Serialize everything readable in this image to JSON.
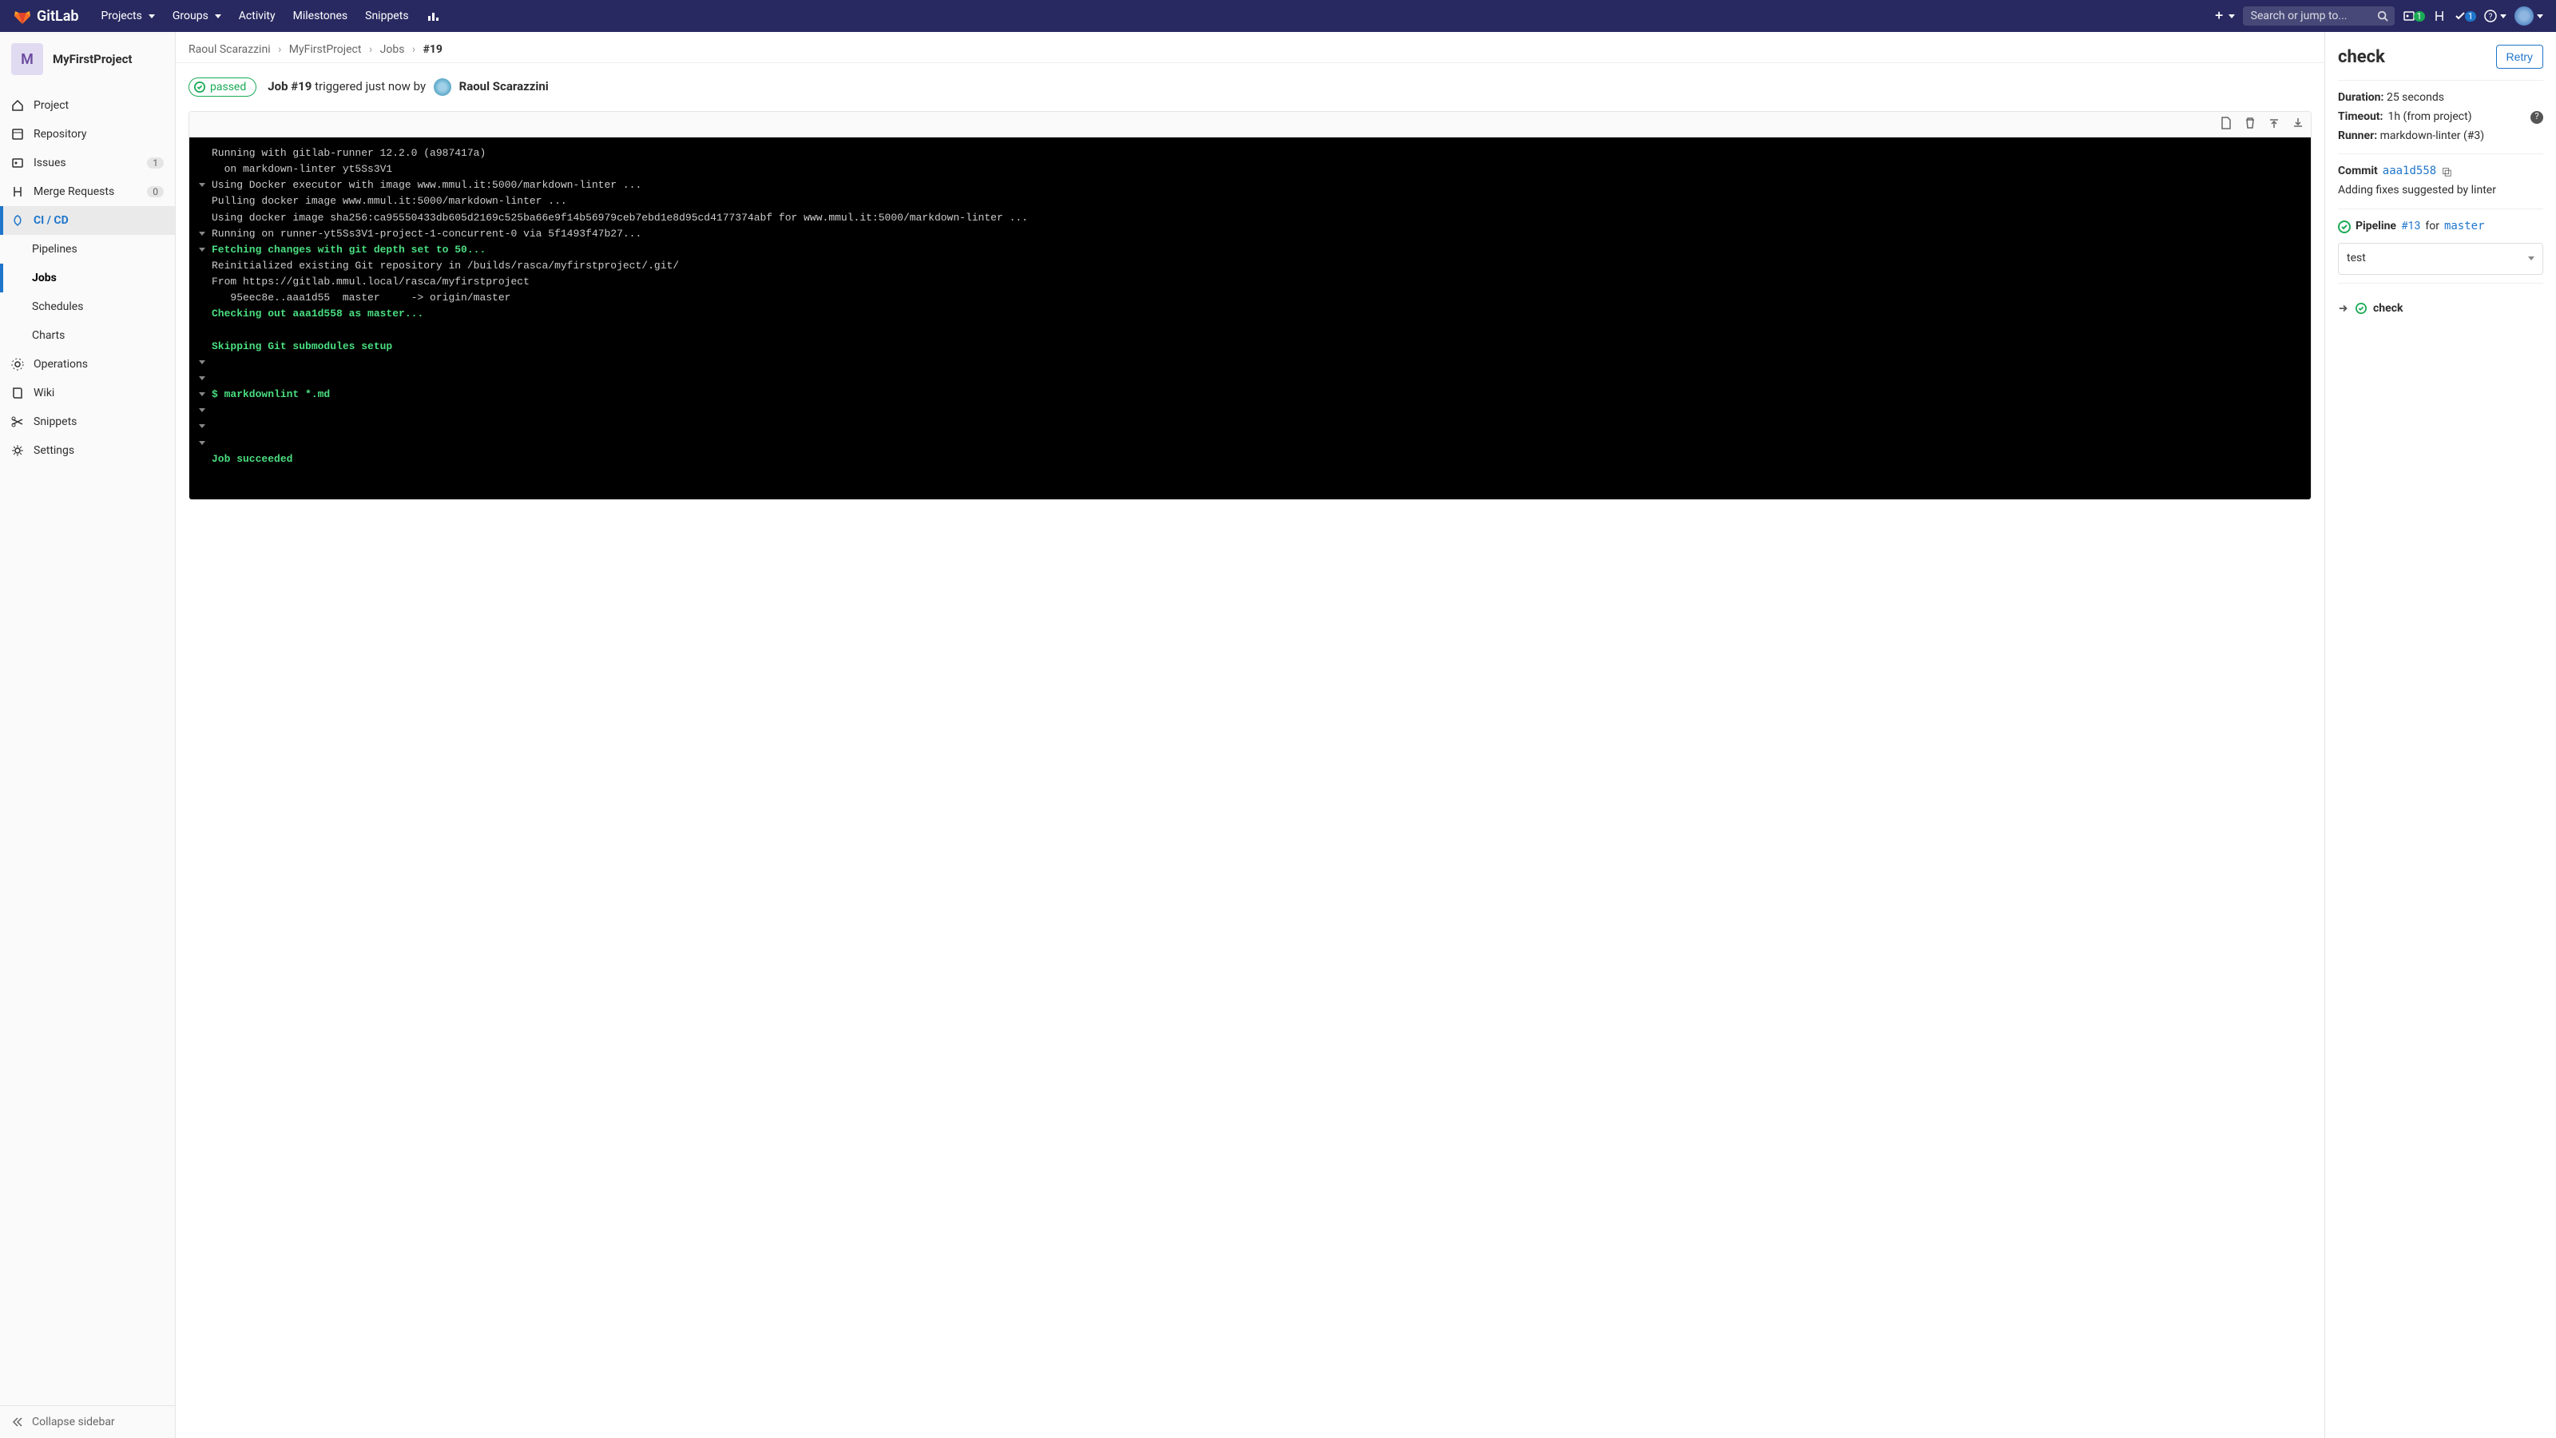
{
  "topnav": {
    "brand": "GitLab",
    "items": [
      "Projects",
      "Groups",
      "Activity",
      "Milestones",
      "Snippets"
    ],
    "search_placeholder": "Search or jump to...",
    "issues_badge": "1",
    "todos_badge": "1"
  },
  "project": {
    "initial": "M",
    "name": "MyFirstProject"
  },
  "sidebar": {
    "project": "Project",
    "repository": "Repository",
    "issues": "Issues",
    "issues_count": "1",
    "merge_requests": "Merge Requests",
    "mr_count": "0",
    "cicd": "CI / CD",
    "pipelines": "Pipelines",
    "jobs": "Jobs",
    "schedules": "Schedules",
    "charts": "Charts",
    "operations": "Operations",
    "wiki": "Wiki",
    "snippets": "Snippets",
    "settings": "Settings",
    "collapse": "Collapse sidebar"
  },
  "crumbs": {
    "owner": "Raoul Scarazzini",
    "project": "MyFirstProject",
    "section": "Jobs",
    "current": "#19"
  },
  "job": {
    "status": "passed",
    "id_label": "Job #19",
    "triggered_text": "triggered just now by",
    "user": "Raoul Scarazzini"
  },
  "log_lines": [
    {
      "t": "Running with gitlab-runner 12.2.0 (a987417a)",
      "style": "plain"
    },
    {
      "t": "  on markdown-linter yt5Ss3V1",
      "style": "plain"
    },
    {
      "t": "Using Docker executor with image www.mmul.it:5000/markdown-linter ...",
      "style": "plain",
      "caret": true
    },
    {
      "t": "Pulling docker image www.mmul.it:5000/markdown-linter ...",
      "style": "plain"
    },
    {
      "t": "Using docker image sha256:ca95550433db605d2169c525ba66e9f14b56979ceb7ebd1e8d95cd4177374abf for www.mmul.it:5000/markdown-linter ...",
      "style": "plain"
    },
    {
      "t": "Running on runner-yt5Ss3V1-project-1-concurrent-0 via 5f1493f47b27...",
      "style": "plain",
      "caret": true
    },
    {
      "t": "Fetching changes with git depth set to 50...",
      "style": "green",
      "caret": true
    },
    {
      "t": "Reinitialized existing Git repository in /builds/rasca/myfirstproject/.git/",
      "style": "plain"
    },
    {
      "t": "From https://gitlab.mmul.local/rasca/myfirstproject",
      "style": "plain"
    },
    {
      "t": "   95eec8e..aaa1d55  master     -> origin/master",
      "style": "plain"
    },
    {
      "t": "Checking out aaa1d558 as master...",
      "style": "green"
    },
    {
      "t": "",
      "style": "plain"
    },
    {
      "t": "Skipping Git submodules setup",
      "style": "green"
    },
    {
      "t": "",
      "style": "plain",
      "caret": true
    },
    {
      "t": "",
      "style": "plain",
      "caret": true
    },
    {
      "t": "$ markdownlint *.md",
      "style": "green",
      "caret": true
    },
    {
      "t": "",
      "style": "plain",
      "caret": true
    },
    {
      "t": "",
      "style": "plain",
      "caret": true
    },
    {
      "t": "",
      "style": "plain",
      "caret": true
    },
    {
      "t": "Job succeeded",
      "style": "green"
    }
  ],
  "right": {
    "title": "check",
    "retry": "Retry",
    "duration_label": "Duration:",
    "duration_value": "25 seconds",
    "timeout_label": "Timeout:",
    "timeout_value": "1h (from project)",
    "runner_label": "Runner:",
    "runner_value": "markdown-linter (#3)",
    "commit_label": "Commit",
    "commit_sha": "aaa1d558",
    "commit_msg": "Adding fixes suggested by linter",
    "pipeline_label": "Pipeline",
    "pipeline_id": "#13",
    "pipeline_for": "for",
    "pipeline_branch": "master",
    "stage": "test",
    "job_name": "check"
  }
}
